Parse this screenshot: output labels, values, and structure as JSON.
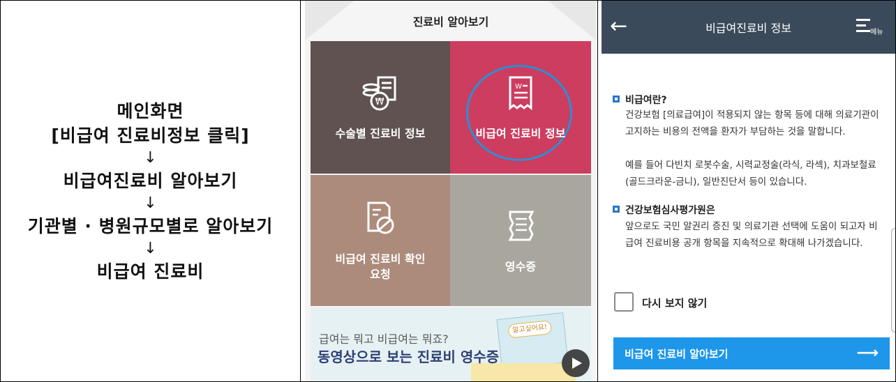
{
  "left": {
    "lines": [
      "메인화면",
      "[비급여 진료비정보 클릭]",
      "↓",
      "비급여진료비 알아보기",
      "↓",
      "기관별 · 병원규모별로 알아보기",
      "↓",
      "비급여 진료비"
    ]
  },
  "middle": {
    "header_title": "진료비 알아보기",
    "tiles": [
      {
        "label": "수술별 진료비 정보",
        "icon": "coin-document-icon",
        "color": "#5f5251"
      },
      {
        "label": "비급여 진료비 정보",
        "icon": "receipt-icon",
        "color": "#cc3d5f"
      },
      {
        "label_line1": "비급여 진료비 확인",
        "label_line2": "요청",
        "icon": "check-document-icon",
        "color": "#ac8b7b"
      },
      {
        "label": "영수증",
        "icon": "list-document-icon",
        "color": "#a8a69d"
      }
    ],
    "banner": {
      "subtitle": "급여는 뭐고 비급여는 뭐죠?",
      "title": "동영상으로 보는 진료비 영수증",
      "tag": "알고싶어요!"
    }
  },
  "right": {
    "header_title": "비급여진료비 정보",
    "menu_label": "메뉴",
    "section1": {
      "heading": "비급여란?",
      "lines": [
        "건강보험 [의료급여]이 적용되지 않는 항목 등에 대해 의료기관이",
        "고지하는 비용의 전액을 환자가 부담하는 것을 말합니다.",
        "",
        "예를 들어 다빈치 로봇수술, 시력교정술(라식, 라섹), 치과보철료",
        "(골드크라운-금니), 일반진단서 등이 있습니다."
      ]
    },
    "section2": {
      "heading": "건강보험심사평가원은",
      "lines": [
        "앞으로도 국민 알권리 증진 및 의료기관 선택에 도움이 되고자 비",
        "급여 진료비용 공개 항목을 지속적으로 확대해 나가겠습니다."
      ]
    },
    "checkbox_label": "다시 보지 않기",
    "button_label": "비급여 진료비 알아보기",
    "button_arrow": "⟶"
  },
  "colors": {
    "header_dark": "#3a4a5a",
    "accent_blue": "#1e96ea",
    "highlight_circle": "#2b8fd6"
  }
}
